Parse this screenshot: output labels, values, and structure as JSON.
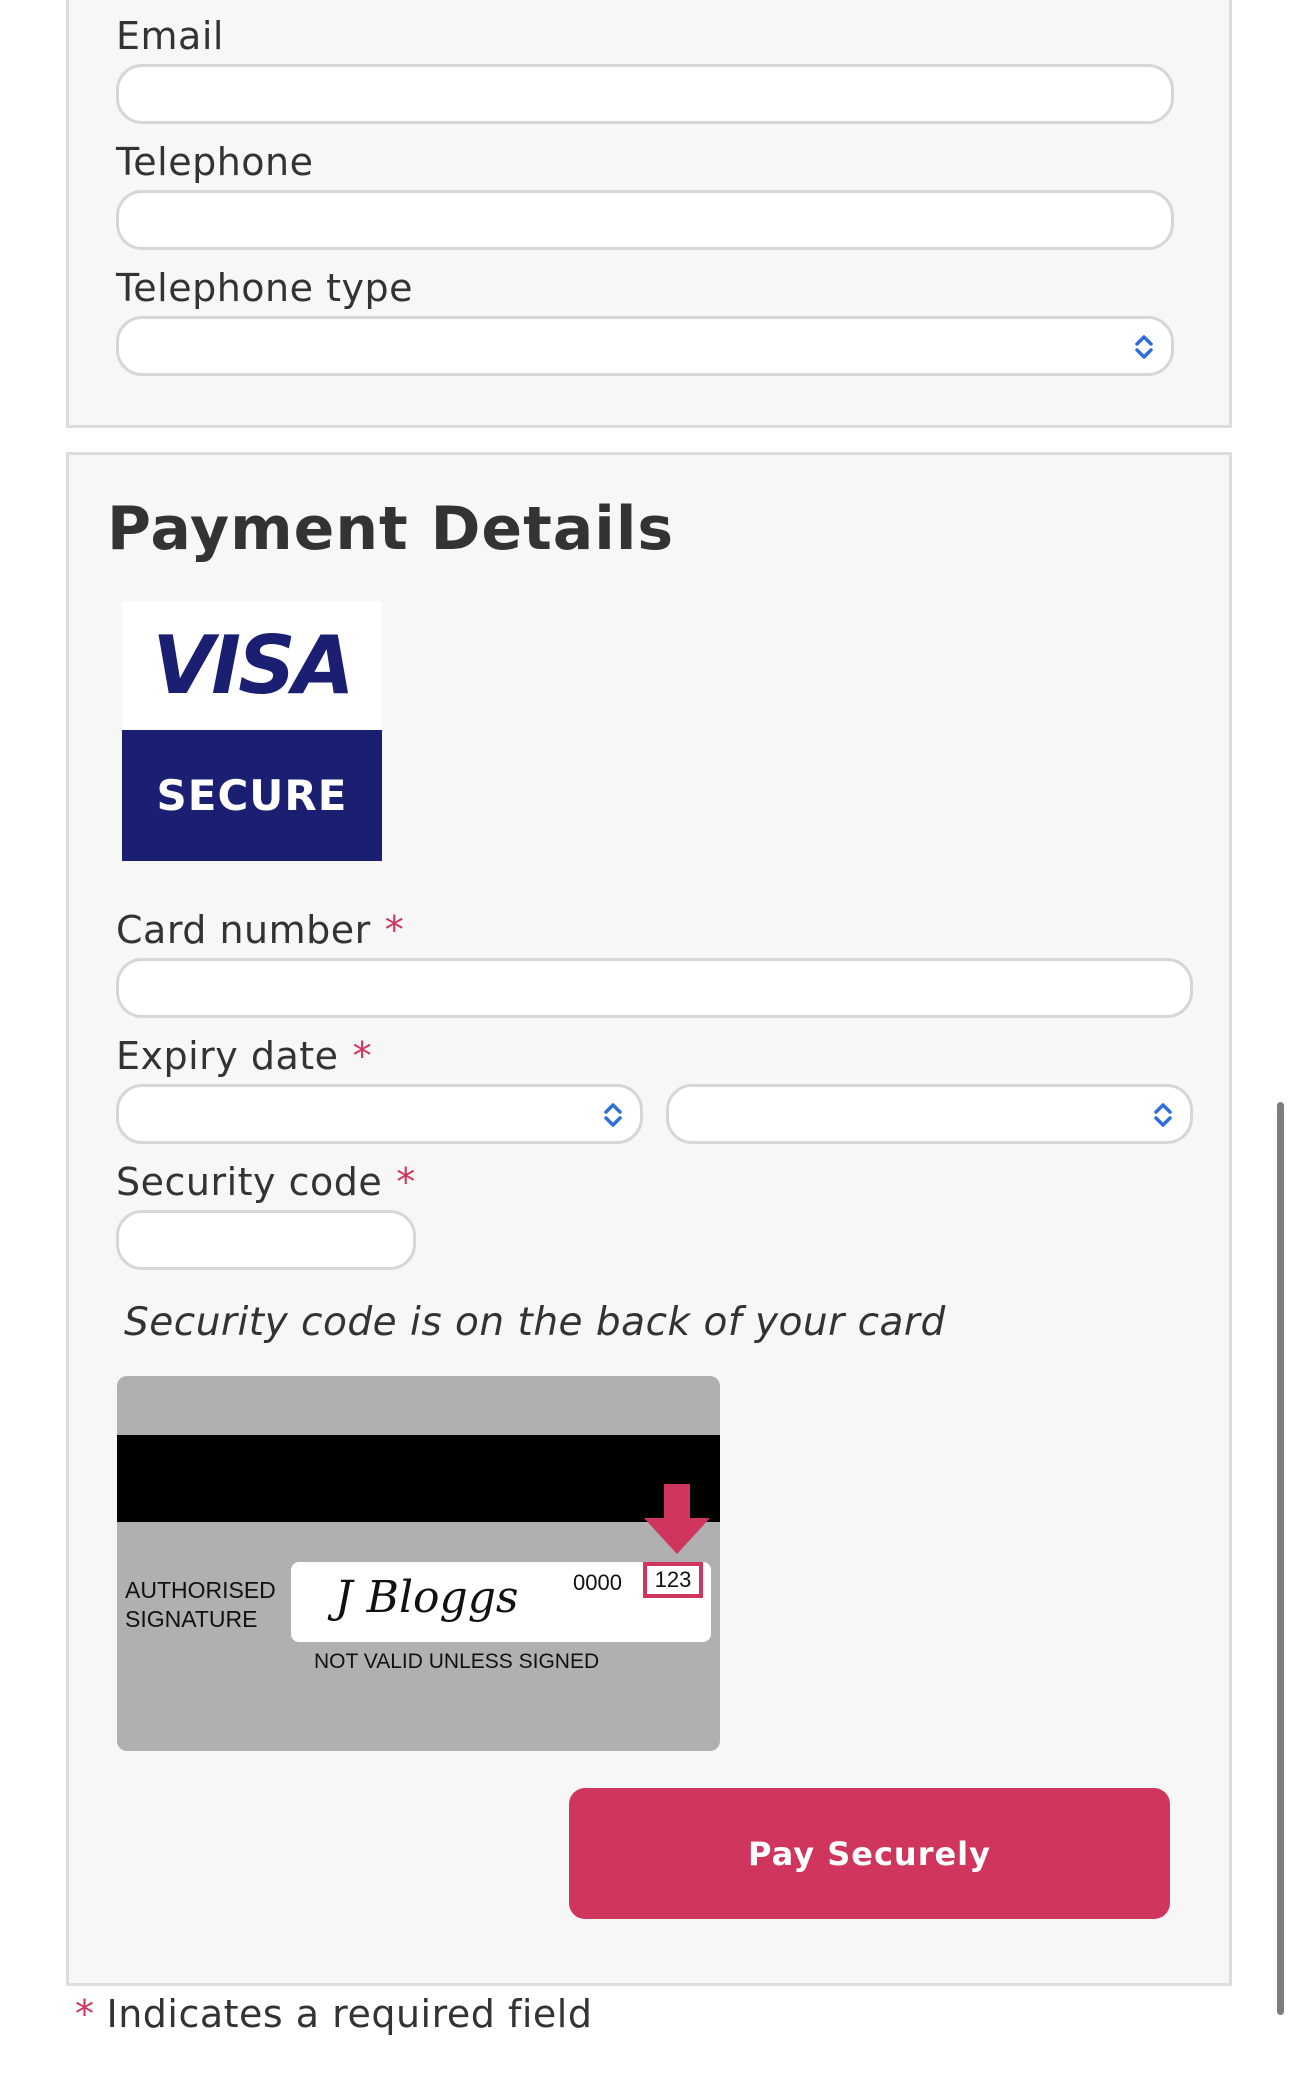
{
  "contact": {
    "email_label": "Email",
    "email_value": "",
    "telephone_label": "Telephone",
    "telephone_value": "",
    "telephone_type_label": "Telephone type",
    "telephone_type_value": ""
  },
  "payment": {
    "title": "Payment Details",
    "visa_logo": {
      "top_text": "VISA",
      "bottom_text": "SECURE",
      "brand_color": "#1a1f71"
    },
    "card_number_label": "Card number",
    "card_number_value": "",
    "expiry_label": "Expiry date",
    "expiry_month_value": "",
    "expiry_year_value": "",
    "security_code_label": "Security code",
    "security_code_value": "",
    "required_marker": "*",
    "security_hint": "Security code is on the back of your card",
    "card_illustration": {
      "authorised_label": "AUTHORISED\nSIGNATURE",
      "signature": "J Bloggs",
      "card_digits": "0000",
      "cvv": "123",
      "not_valid_text": "NOT VALID UNLESS SIGNED"
    },
    "pay_button_label": "Pay Securely"
  },
  "footer": {
    "required_marker": "*",
    "required_note": "Indicates a required field"
  },
  "colors": {
    "accent": "#d0355e",
    "panel_bg": "#f7f7f7",
    "panel_border": "#dcdcdc"
  },
  "icons": {
    "select_arrow": "chevron-up-down-icon",
    "cvv_pointer": "arrow-down-icon"
  }
}
